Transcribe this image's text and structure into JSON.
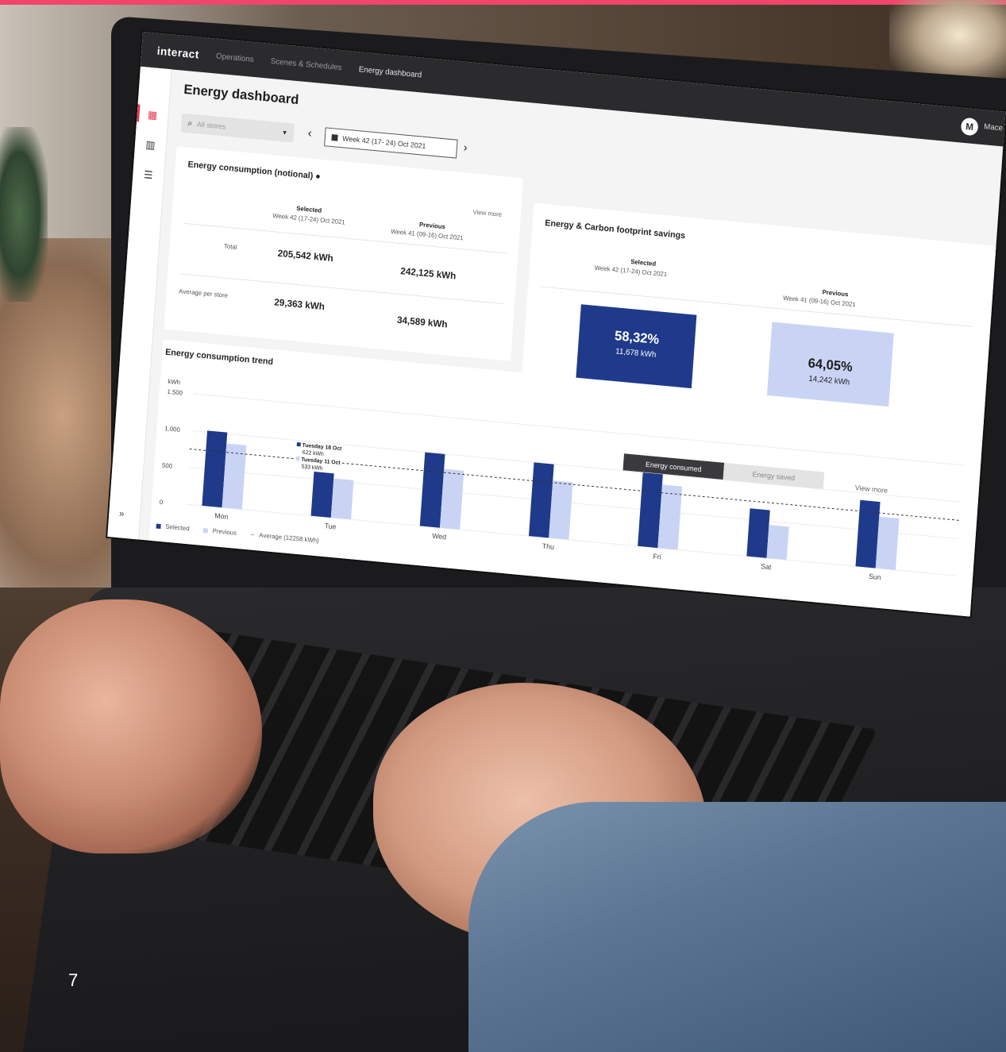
{
  "app": {
    "brand": "interact",
    "nav": [
      "Operations",
      "Scenes & Schedules",
      "Energy dashboard"
    ],
    "page_title": "Energy dashboard",
    "user_initial": "M",
    "user_name": "Mace"
  },
  "filters": {
    "store_placeholder": "All stores",
    "week_label": "Week 42 (17- 24) Oct 2021"
  },
  "consumption": {
    "title": "Energy consumption (notional)",
    "view_more": "View more",
    "selected_label": "Selected",
    "selected_period": "Week 42 (17-24) Oct 2021",
    "previous_label": "Previous",
    "previous_period": "Week 41 (09-16) Oct 2021",
    "rows": [
      {
        "label": "Total",
        "selected": "205,542 kWh",
        "previous": "242,125 kWh"
      },
      {
        "label": "Average per store",
        "selected": "29,363 kWh",
        "previous": "34,589 kWh"
      }
    ]
  },
  "savings": {
    "title": "Energy & Carbon footprint savings",
    "selected_label": "Selected",
    "selected_period": "Week 42 (17-24) Oct 2021",
    "previous_label": "Previous",
    "previous_period": "Week 41 (09-16) Oct 2021",
    "selected_pct": "58,32%",
    "selected_kwh": "11,678 kWh",
    "previous_pct": "64,05%",
    "previous_kwh": "14,242 kWh",
    "selected_color": "#1f3a8a",
    "previous_color": "#c9d4f5"
  },
  "trend": {
    "title": "Energy consumption trend",
    "toggle_on": "Energy consumed",
    "toggle_off": "Energy saved",
    "view_more": "View more",
    "tooltip": {
      "line1": "Tuesday 18 Oct",
      "line2": "622 kWh",
      "line3": "Tuesday 11 Oct",
      "line4": "533 kWh"
    },
    "legend": {
      "selected": "Selected",
      "previous": "Previous",
      "average": "Average (12258 kWh)"
    }
  },
  "chart_data": {
    "type": "bar",
    "title": "Energy consumption trend",
    "ylabel": "kWh",
    "ylim": [
      0,
      1500
    ],
    "yticks": [
      "0",
      "500",
      "1.000",
      "1.500"
    ],
    "categories": [
      "Mon",
      "Tue",
      "Wed",
      "Thu",
      "Fri",
      "Sat",
      "Sun"
    ],
    "series": [
      {
        "name": "Selected",
        "color": "#1f3a8a",
        "values": [
          1020,
          622,
          1000,
          1000,
          1000,
          650,
          900
        ]
      },
      {
        "name": "Previous",
        "color": "#c9d4f5",
        "values": [
          870,
          533,
          800,
          780,
          860,
          450,
          700
        ]
      }
    ],
    "average": 750,
    "average_label": "Average (12258 kWh)",
    "grid": true,
    "legend_position": "bottom-left"
  },
  "page_number": "7"
}
